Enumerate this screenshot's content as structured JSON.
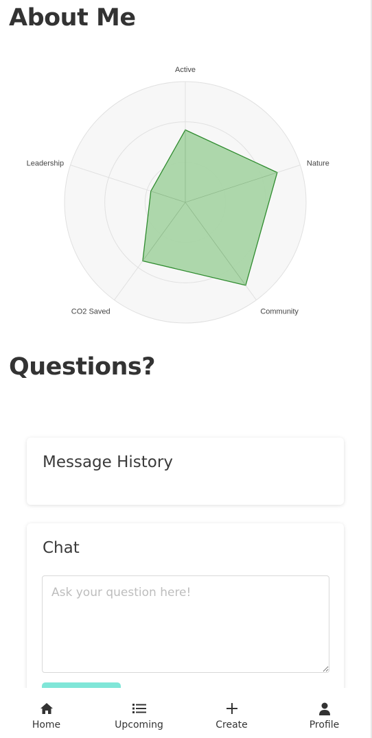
{
  "about": {
    "title": "About Me"
  },
  "chart_data": {
    "type": "radar",
    "axes": [
      "Active",
      "Nature",
      "Community",
      "CO2 Saved",
      "Leadership"
    ],
    "values": [
      0.6,
      0.8,
      0.85,
      0.6,
      0.3
    ],
    "rings": 3,
    "fill_color": "#a9d5a6",
    "stroke_color": "#2e8b2e",
    "grid_color": "#e0e0e0",
    "background_color": "#f7f7f7"
  },
  "questions": {
    "title": "Questions?"
  },
  "history": {
    "title": "Message History"
  },
  "chat": {
    "title": "Chat",
    "placeholder": "Ask your question here!",
    "value": ""
  },
  "send_button": {
    "color": "#80e6d8"
  },
  "nav": {
    "items": [
      {
        "label": "Home",
        "icon": "home-icon"
      },
      {
        "label": "Upcoming",
        "icon": "list-icon"
      },
      {
        "label": "Create",
        "icon": "plus-icon"
      },
      {
        "label": "Profile",
        "icon": "person-icon"
      }
    ]
  }
}
